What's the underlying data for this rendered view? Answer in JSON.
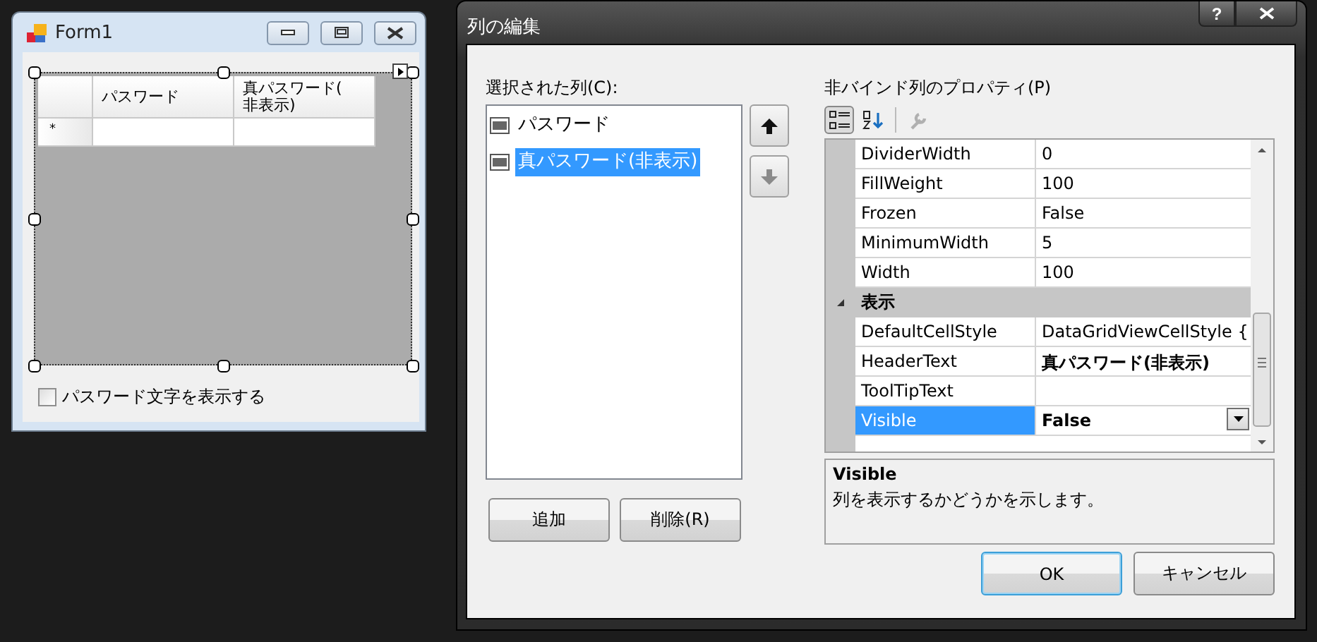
{
  "form_window": {
    "title": "Form1",
    "grid": {
      "columns": [
        "パスワード",
        "真パスワード(\n非表示)"
      ],
      "new_row_marker": "*"
    },
    "checkbox": {
      "label": "パスワード文字を表示する",
      "checked": false
    }
  },
  "dialog": {
    "title": "列の編集",
    "help_button": "?",
    "columns_label": "選択された列(C):",
    "columns": [
      {
        "label": "パスワード",
        "selected": false
      },
      {
        "label": "真パスワード(非表示)",
        "selected": true
      }
    ],
    "move_up": {
      "disabled": false
    },
    "move_down": {
      "disabled": true
    },
    "add_button": "追加",
    "remove_button": "削除(R)",
    "properties_label": "非バインド列のプロパティ(P)",
    "toolbar": [
      {
        "kind": "categorized",
        "selected": true
      },
      {
        "kind": "alphabetical",
        "selected": false
      },
      {
        "kind": "pages",
        "selected": false
      }
    ],
    "properties": [
      {
        "kind": "property",
        "name": "DividerWidth",
        "value": "0",
        "bold": false,
        "selected": false
      },
      {
        "kind": "property",
        "name": "FillWeight",
        "value": "100",
        "bold": false,
        "selected": false
      },
      {
        "kind": "property",
        "name": "Frozen",
        "value": "False",
        "bold": false,
        "selected": false
      },
      {
        "kind": "property",
        "name": "MinimumWidth",
        "value": "5",
        "bold": false,
        "selected": false
      },
      {
        "kind": "property",
        "name": "Width",
        "value": "100",
        "bold": false,
        "selected": false
      },
      {
        "kind": "category",
        "name": "表示",
        "expanded": true
      },
      {
        "kind": "property",
        "name": "DefaultCellStyle",
        "value": "DataGridViewCellStyle {",
        "bold": false,
        "selected": false
      },
      {
        "kind": "property",
        "name": "HeaderText",
        "value": "真パスワード(非表示)",
        "bold": true,
        "selected": false
      },
      {
        "kind": "property",
        "name": "ToolTipText",
        "selected": false
      },
      {
        "kind": "property",
        "name": "Visible",
        "value": "False",
        "bold": true,
        "selected": true
      }
    ],
    "description": {
      "title": "Visible",
      "text": "列を表示するかどうかを示します。"
    },
    "ok_button": "OK",
    "cancel_button": "キャンセル"
  }
}
